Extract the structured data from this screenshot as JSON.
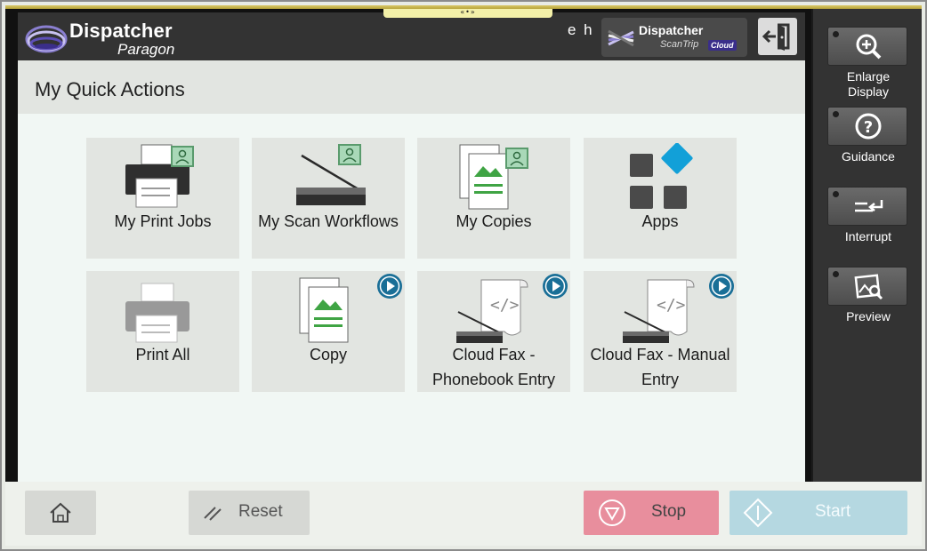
{
  "colors": {
    "header_bg": "#333333",
    "tile_bg": "#e2e5e1",
    "accent_blue": "#1a6f97",
    "green": "#3fa444",
    "stop": "#e88e9d",
    "start": "#b5d8e1"
  },
  "header": {
    "brand_name": "Dispatcher",
    "brand_product": "Paragon",
    "user_initials": "e h",
    "scantrip": {
      "name": "Dispatcher",
      "product": "ScanTrip",
      "tag": "Cloud"
    },
    "logout_icon": "logout-door-icon"
  },
  "top_handle": "«•»",
  "section_title": "My Quick Actions",
  "tiles": [
    {
      "label": "My Print Jobs",
      "icon": "printer-user-icon"
    },
    {
      "label": "My Scan Workflows",
      "icon": "scanner-user-icon"
    },
    {
      "label": "My Copies",
      "icon": "copy-user-icon"
    },
    {
      "label": "Apps",
      "icon": "apps-grid-icon"
    },
    {
      "label": "Print All",
      "icon": "printer-icon"
    },
    {
      "label": "Copy",
      "icon": "copy-icon",
      "play": true
    },
    {
      "label_line1": "Cloud Fax -",
      "label_line2": "Phonebook Entry",
      "icon": "cloud-fax-icon",
      "play": true
    },
    {
      "label_line1": "Cloud Fax - Manual",
      "label_line2": "Entry",
      "icon": "cloud-fax-icon",
      "play": true
    }
  ],
  "side_panel": {
    "enlarge_line1": "Enlarge",
    "enlarge_line2": "Display",
    "guidance": "Guidance",
    "interrupt": "Interrupt",
    "preview": "Preview"
  },
  "bottom": {
    "reset": "Reset",
    "stop": "Stop",
    "start": "Start"
  }
}
